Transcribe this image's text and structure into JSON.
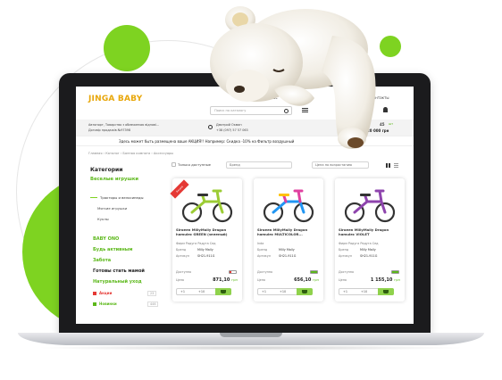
{
  "site": {
    "logo": "JINGA BABY",
    "top_links": [
      "Главная",
      "О нас",
      "Спо..."
    ],
    "top_link_right": "Контакты",
    "search_placeholder": "Поиск по каталогу",
    "address_line1": "Автопорт, Товарство з обмеженою відпові...",
    "address_line2": "Договір продажів №97398",
    "phone_label": "Дмитрий Окман",
    "phone": "+38 (097) 57 57 063",
    "cart_count": "45",
    "cart_total": "20 000 грн",
    "cart_prefix": "шт",
    "promo": "Здесь может быть размещена ваше  АКЦИЯ!! Например: Скидка  -10% на Фильтр воздушный",
    "breadcrumbs": "Главная › Каталог › Банная комната › Аксессуары"
  },
  "sidebar": {
    "title": "Категории",
    "highlight": "Веселые игрушки",
    "subcat": "Тракторы и велосипеды",
    "items": [
      "Мягкие игрушки",
      "Куклы"
    ],
    "groups": [
      "BABY ONO",
      "Будь активным",
      "Забота",
      "Готовы стать мамой",
      "Натуральный уход"
    ],
    "promo_items": [
      {
        "label": "Акции",
        "count": "23"
      },
      {
        "label": "Новинки",
        "count": "446"
      }
    ]
  },
  "filters": {
    "only_available": "Только доступные",
    "brand": "Бренд",
    "sort": "Цена по возрастанию"
  },
  "products": [
    {
      "name": "Siroeen MillyMally Dragon hamulec GREEN (зеленый)",
      "seller": "Фирм Радуга Радуга Сед",
      "brand_label": "Бренд",
      "brand": "Milly Mally",
      "article_label": "Артикул",
      "article": "SH21-911G",
      "availability": "Доступно",
      "price_label": "Цена",
      "price": "871,10",
      "currency": "грн",
      "badge": "Акция",
      "qty1": "+1",
      "qty2": "+10",
      "stock": 0.3
    },
    {
      "name": "Siroeen MillyMally Dragon hamulec MULTICOLOR...",
      "seller": "Inda",
      "brand_label": "Бренд",
      "brand": "Milly Mally",
      "article_label": "Артикул",
      "article": "SH21-911G",
      "availability": "Доступно",
      "price_label": "Цена",
      "price": "656,10",
      "currency": "грн",
      "badge": "",
      "qty1": "+1",
      "qty2": "+10",
      "stock": 1.0
    },
    {
      "name": "Siroeen MillyMally Dragon hamulec VIOLET",
      "seller": "Фирм Радуга Радуга Сед",
      "brand_label": "Бренд",
      "brand": "Milly Mally",
      "article_label": "Артикул",
      "article": "SH21-911G",
      "availability": "Доступно",
      "price_label": "Цена",
      "price": "1 155,10",
      "currency": "грн",
      "badge": "",
      "qty1": "+1",
      "qty2": "+10",
      "stock": 1.0
    }
  ],
  "colors": {
    "accent": "#7ed321",
    "logo": "#e8a70b",
    "bike1": "#9ccc34",
    "bike2": "#e040a0",
    "bike3": "#8e44ad"
  }
}
